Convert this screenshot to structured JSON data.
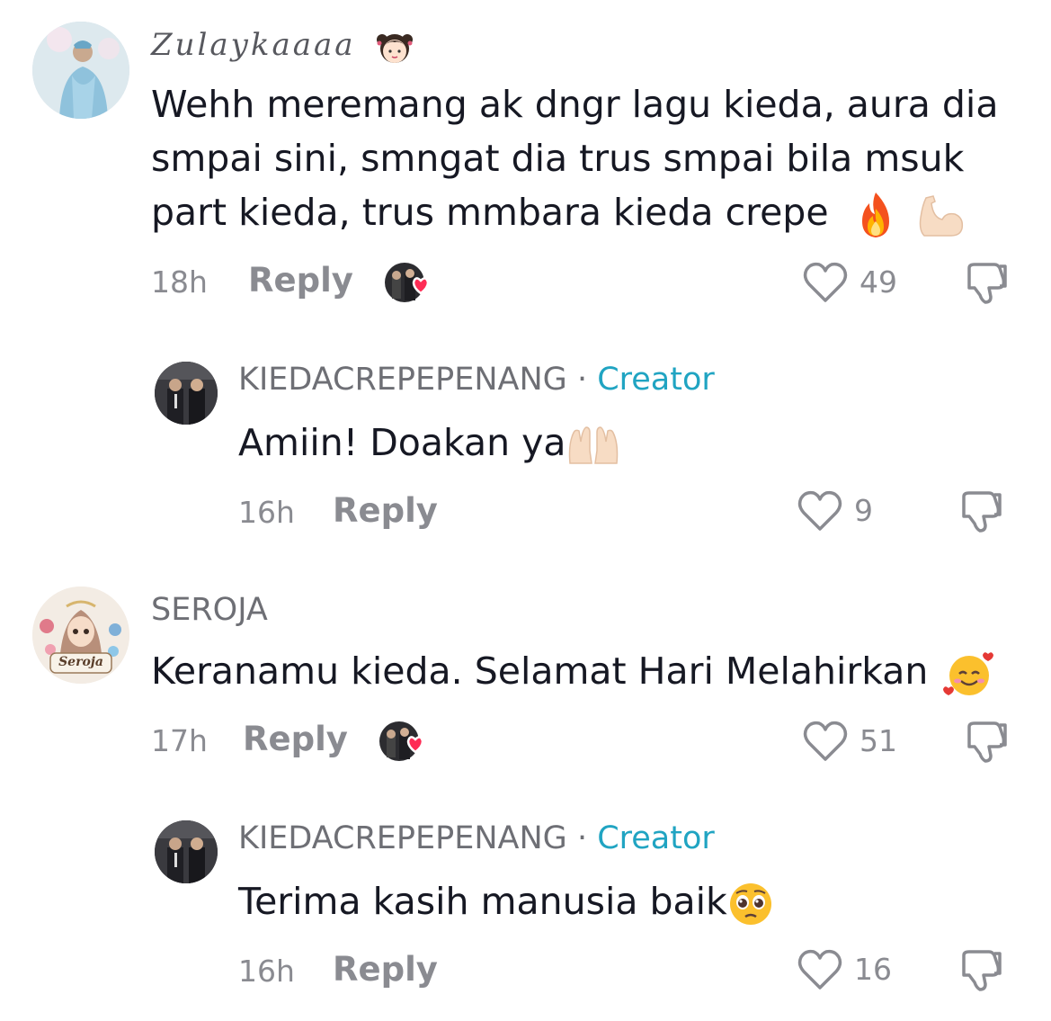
{
  "comments": [
    {
      "username": "Zulaykaaaa",
      "text_lines": [
        "Wehh meremang ak dngr lagu kieda, aura dia",
        "smpai sini, smngat dia trus smpai bila msuk",
        "part kieda, trus mmbara kieda crepe"
      ],
      "time": "18h",
      "reply_label": "Reply",
      "likes": "49",
      "creator_liked": true,
      "emojis": [
        "fire-emoji",
        "flexed-biceps-emoji",
        "girl-face-emoji"
      ]
    },
    {
      "username": "KIEDACREPEPENANG",
      "separator": "·",
      "badge": "Creator",
      "text": "Amiin! Doakan ya",
      "time": "16h",
      "reply_label": "Reply",
      "likes": "9",
      "emojis": [
        "palms-up-together-emoji"
      ]
    },
    {
      "username": "SEROJA",
      "avatar_text": "Seroja",
      "text": "Keranamu kieda. Selamat Hari Melahirkan",
      "time": "17h",
      "reply_label": "Reply",
      "likes": "51",
      "creator_liked": true,
      "emojis": [
        "smiling-face-with-hearts-emoji"
      ]
    },
    {
      "username": "KIEDACREPEPENANG",
      "separator": "·",
      "badge": "Creator",
      "text": "Terima kasih manusia baik",
      "time": "16h",
      "reply_label": "Reply",
      "likes": "16",
      "emojis": [
        "pleading-face-emoji"
      ]
    }
  ],
  "colors": {
    "creator_badge": "#20a4c2",
    "meta_gray": "#8a8b91",
    "heart_red": "#fe2c55"
  }
}
